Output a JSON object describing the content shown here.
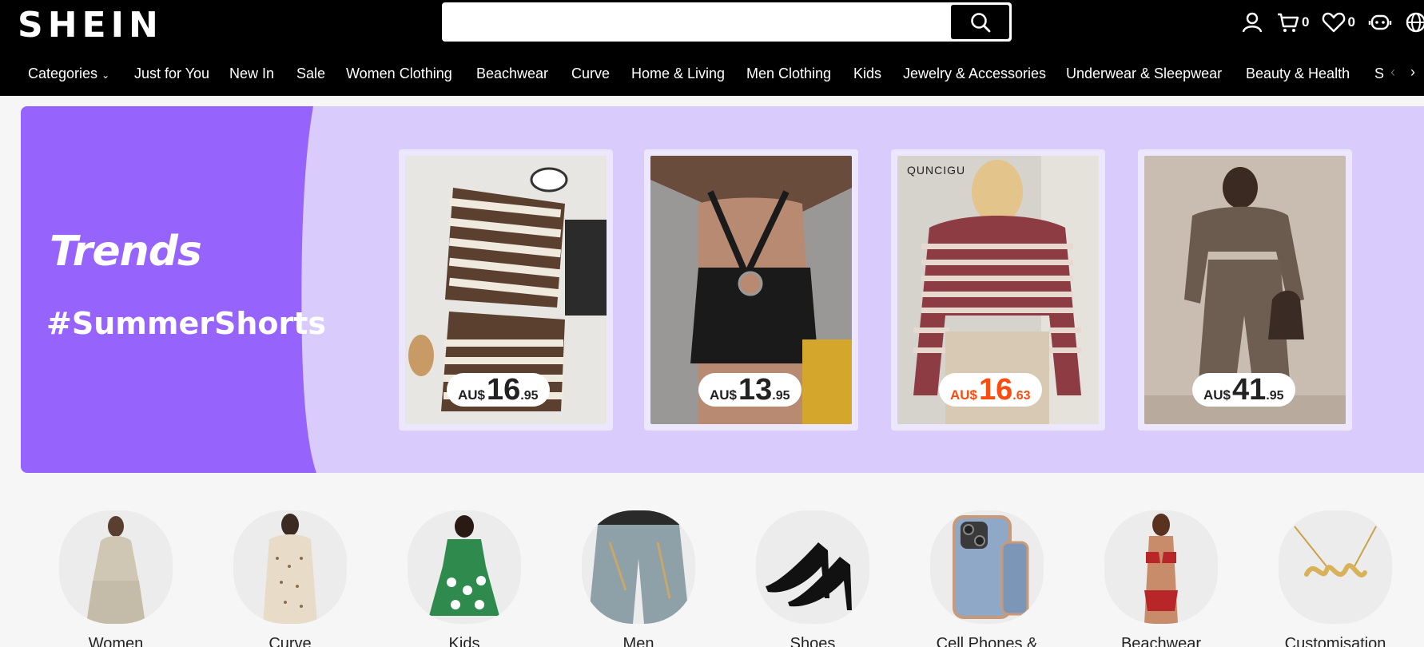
{
  "header": {
    "logo": "SHEIN",
    "search_placeholder": "",
    "cart_count": "0",
    "wishlist_count": "0"
  },
  "nav": {
    "items": [
      "Categories",
      "Just for You",
      "New In",
      "Sale",
      "Women Clothing",
      "Beachwear",
      "Curve",
      "Home & Living",
      "Men Clothing",
      "Kids",
      "Jewelry & Accessories",
      "Underwear & Sleepwear",
      "Beauty & Health",
      "S"
    ]
  },
  "banner": {
    "logo": "Trends",
    "hashtag": "#SummerShorts",
    "bg_color": "#d9ccfd",
    "left_color": "#9763fd",
    "products": [
      {
        "currency": "AU$",
        "int": "16",
        "dec": ".95",
        "sale": false,
        "brand": ""
      },
      {
        "currency": "AU$",
        "int": "13",
        "dec": ".95",
        "sale": false,
        "brand": ""
      },
      {
        "currency": "AU$",
        "int": "16",
        "dec": ".63",
        "sale": true,
        "brand": "QUNCIGU"
      },
      {
        "currency": "AU$",
        "int": "41",
        "dec": ".95",
        "sale": false,
        "brand": ""
      }
    ]
  },
  "categories": [
    {
      "label": "Women"
    },
    {
      "label": "Curve"
    },
    {
      "label": "Kids"
    },
    {
      "label": "Men"
    },
    {
      "label": "Shoes"
    },
    {
      "label": "Cell Phones &"
    },
    {
      "label": "Beachwear"
    },
    {
      "label": "Customisation"
    }
  ]
}
